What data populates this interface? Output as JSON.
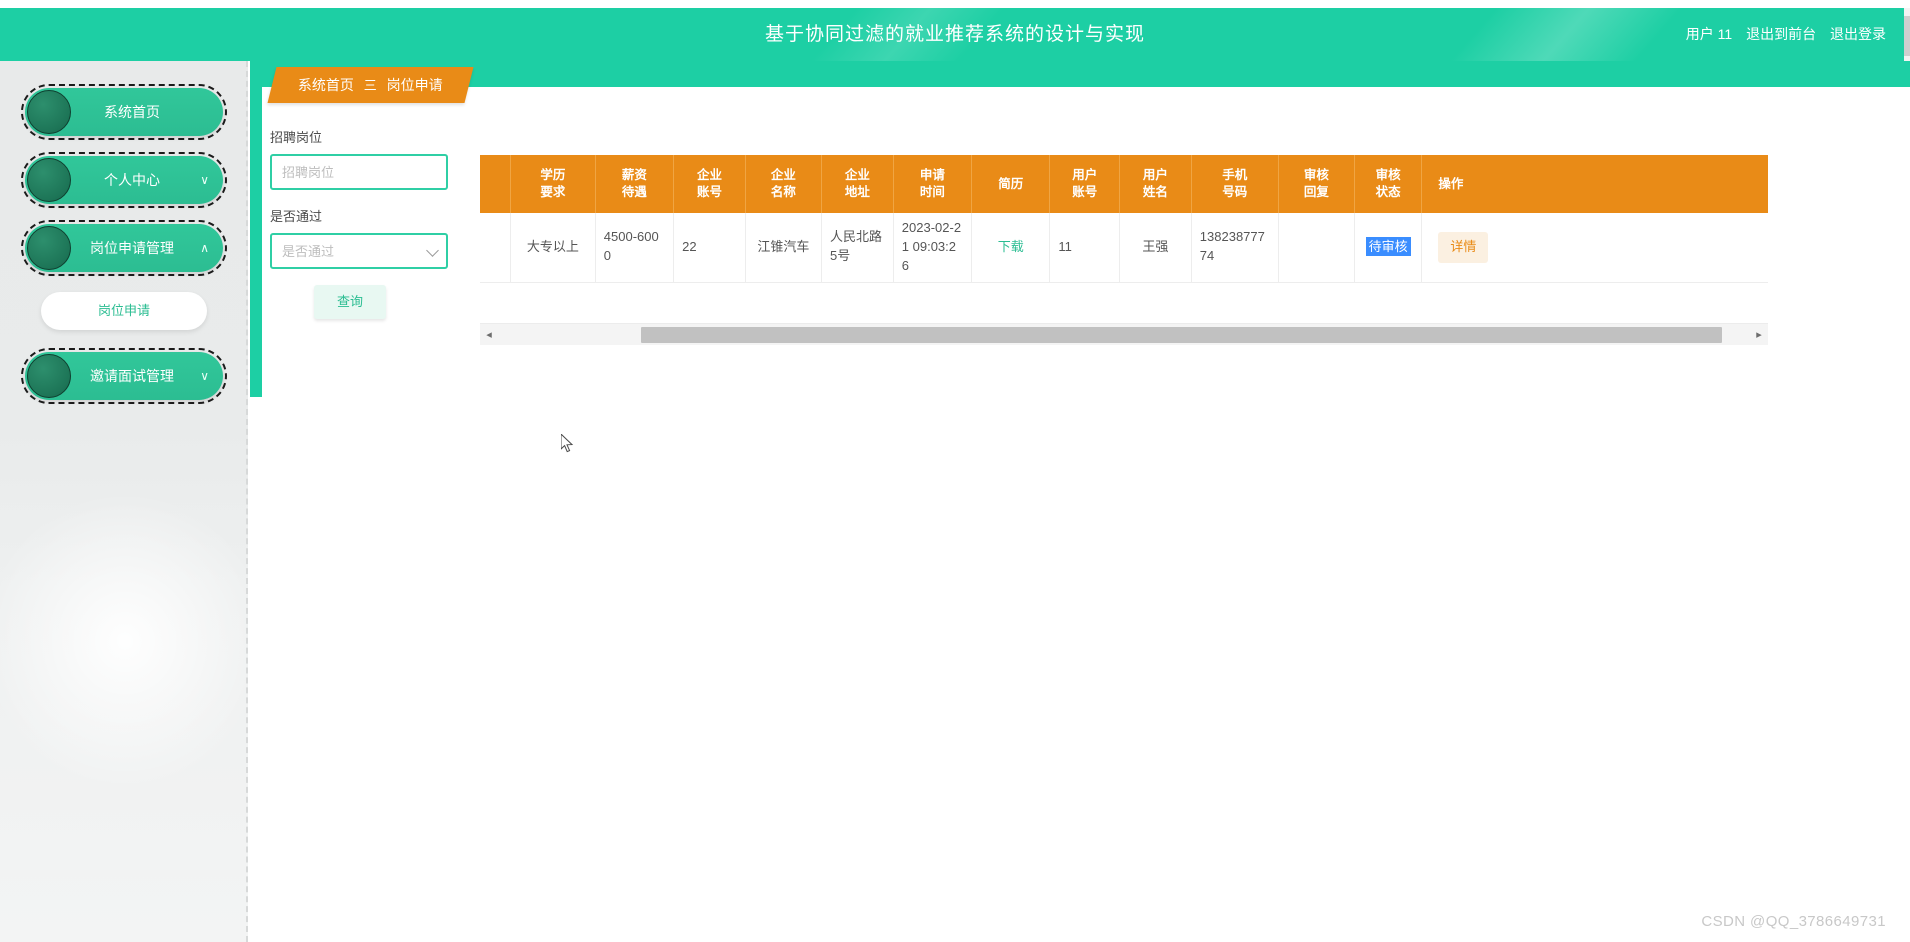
{
  "header": {
    "title": "基于协同过滤的就业推荐系统的设计与实现",
    "user_label": "用户 11",
    "exit_front_label": "退出到前台",
    "logout_label": "退出登录",
    "bg_color": "#1dcfa4"
  },
  "sidebar": {
    "items": [
      {
        "label": "系统首页",
        "chevron": "",
        "name": "home"
      },
      {
        "label": "个人中心",
        "chevron": "∨",
        "name": "personal-center"
      },
      {
        "label": "岗位申请管理",
        "chevron": "∧",
        "name": "job-application-management"
      }
    ],
    "submenu": [
      {
        "label": "岗位申请",
        "name": "job-application"
      }
    ],
    "items_after": [
      {
        "label": "邀请面试管理",
        "chevron": "∨",
        "name": "invite-interview-management"
      }
    ]
  },
  "breadcrumb": {
    "root": "系统首页",
    "separator": "三",
    "current": "岗位申请",
    "tab_color": "#e98b17"
  },
  "filters": {
    "job_label": "招聘岗位",
    "job_placeholder": "招聘岗位",
    "job_value": "",
    "pass_label": "是否通过",
    "pass_placeholder": "是否通过",
    "pass_value": "",
    "query_label": "查询"
  },
  "table": {
    "columns": [
      "",
      "学历\n要求",
      "薪资\n待遇",
      "企业\n账号",
      "企业\n名称",
      "企业\n地址",
      "申请\n时间",
      "简历",
      "用户\n账号",
      "用户\n姓名",
      "手机\n号码",
      "审核\n回复",
      "审核\n状态",
      "操作"
    ],
    "columns_line1": [
      "",
      "学历",
      "薪资",
      "企业",
      "企业",
      "企业",
      "申请",
      "简历",
      "用户",
      "用户",
      "手机",
      "审核",
      "审核",
      "操作"
    ],
    "columns_line2": [
      "",
      "要求",
      "待遇",
      "账号",
      "名称",
      "地址",
      "时间",
      "",
      "账号",
      "姓名",
      "号码",
      "回复",
      "状态",
      ""
    ],
    "rows": [
      {
        "blank": "",
        "education": "大专以上",
        "salary": "4500-6000",
        "company_account": "22",
        "company_name": "江锥汽车",
        "company_address": "人民北路5号",
        "apply_time": "2023-02-21 09:03:26",
        "resume": "下载",
        "user_account": "11",
        "user_name": "王强",
        "phone": "13823877774",
        "review_reply": "",
        "review_status": "待审核",
        "action": "详情"
      }
    ]
  },
  "scrollbar": {
    "left_arrow": "◂",
    "right_arrow": "▸"
  },
  "watermark": "CSDN @QQ_3786649731"
}
